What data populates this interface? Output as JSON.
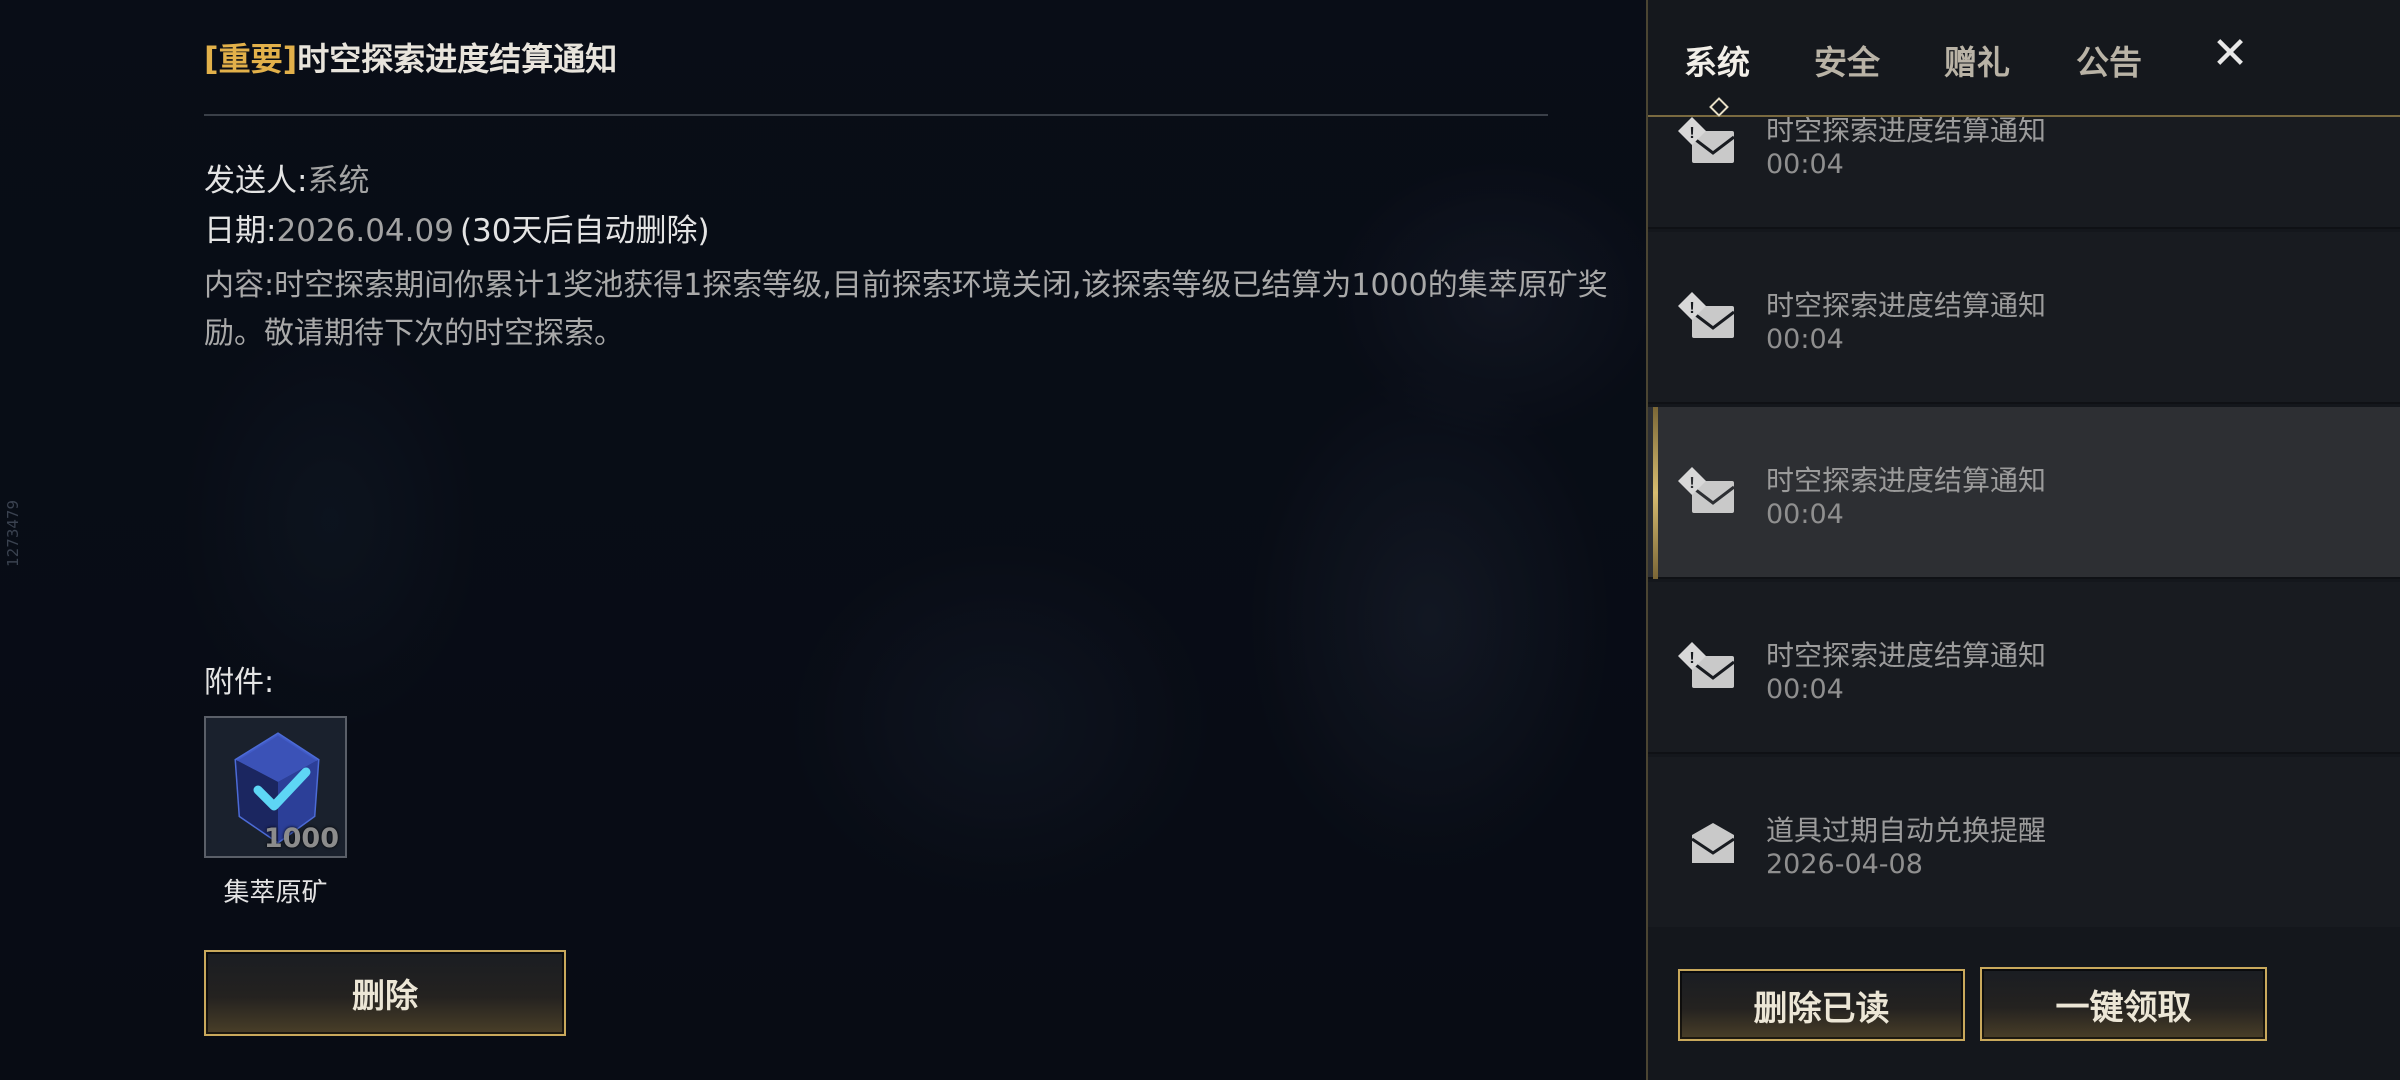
{
  "side_id": "1273479",
  "detail": {
    "title_tag": "[重要]",
    "title": "时空探索进度结算通知",
    "sender_label": "发送人:",
    "sender": "系统",
    "date_label": "日期:",
    "date": "2026.04.09",
    "expire_note": "(30天后自动删除)",
    "content": "内容:时空探索期间你累计1奖池获得1探索等级,目前探索环境关闭,该探索等级已结算为1000的集萃原矿奖励。敬请期待下次的时空探索。",
    "attachment_label": "附件:",
    "attachment": {
      "name": "集萃原矿",
      "quantity": "1000",
      "icon": "crystal-check-icon"
    },
    "delete_label": "删除"
  },
  "panel": {
    "tabs": [
      {
        "label": "系统",
        "active": true
      },
      {
        "label": "安全",
        "active": false
      },
      {
        "label": "赠礼",
        "active": false
      },
      {
        "label": "公告",
        "active": false
      }
    ],
    "close_icon": "close-icon",
    "mails": [
      {
        "title": "时空探索进度结算通知",
        "time": "00:04",
        "icon": "important-mail-icon",
        "selected": false
      },
      {
        "title": "时空探索进度结算通知",
        "time": "00:04",
        "icon": "important-mail-icon",
        "selected": false
      },
      {
        "title": "时空探索进度结算通知",
        "time": "00:04",
        "icon": "important-mail-icon",
        "selected": true
      },
      {
        "title": "时空探索进度结算通知",
        "time": "00:04",
        "icon": "important-mail-icon",
        "selected": false
      },
      {
        "title": "道具过期自动兑换提醒",
        "time": "2026-04-08",
        "icon": "opened-mail-icon",
        "selected": false
      }
    ],
    "delete_read_label": "删除已读",
    "claim_all_label": "一键领取"
  },
  "colors": {
    "accent_gold": "#c9a95c",
    "tag_orange": "#e2b04a",
    "panel_bg": "#14171c"
  }
}
